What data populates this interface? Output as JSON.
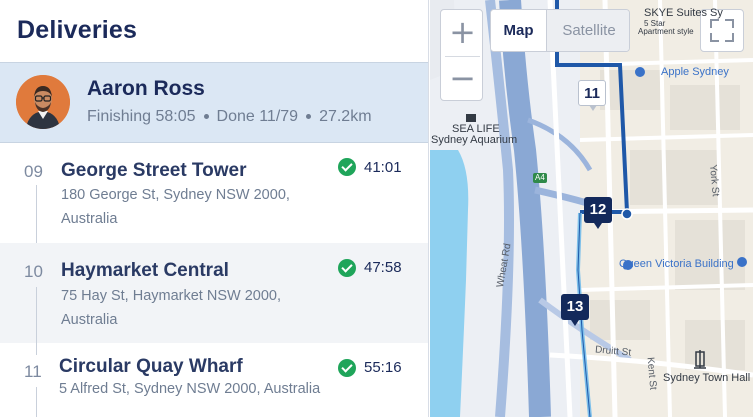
{
  "header": {
    "title": "Deliveries"
  },
  "driver": {
    "name": "Aaron Ross",
    "finishing": "Finishing 58:05",
    "done": "Done 11/79",
    "distance": "27.2km"
  },
  "stops": [
    {
      "number": "09",
      "name": "George Street Tower",
      "address": "180 George St, Sydney NSW 2000, Australia",
      "time": "41:01",
      "status": "done"
    },
    {
      "number": "10",
      "name": "Haymarket Central",
      "address": "75 Hay St, Haymarket NSW 2000, Australia",
      "time": "47:58",
      "status": "done"
    },
    {
      "number": "11",
      "name": "Circular Quay Wharf",
      "address": "5 Alfred St, Sydney NSW 2000, Australia",
      "time": "55:16",
      "status": "done"
    }
  ],
  "map": {
    "zoom_in": "+",
    "zoom_out": "−",
    "type_map": "Map",
    "type_satellite": "Satellite",
    "markers": {
      "m11": "11",
      "m12": "12",
      "m13": "13"
    },
    "labels": {
      "skye": "SKYE Suites Sy",
      "skye_sub1": "5 Star",
      "skye_sub2": "Apartment style",
      "apple": "Apple Sydney",
      "sealife1": "SEA LIFE",
      "sealife2": "Sydney Aquarium",
      "qvb": "Queen Victoria Building",
      "townhall": "Sydney Town Hall",
      "druitt": "Druitt St",
      "wheat": "Wheat Rd",
      "york": "York St",
      "kent": "Kent St",
      "a4": "A4"
    },
    "colors": {
      "route_dark": "#1f58a8",
      "route_light": "#7ec0ea",
      "water": "#8fd0f0",
      "land": "#f1ede4"
    }
  }
}
